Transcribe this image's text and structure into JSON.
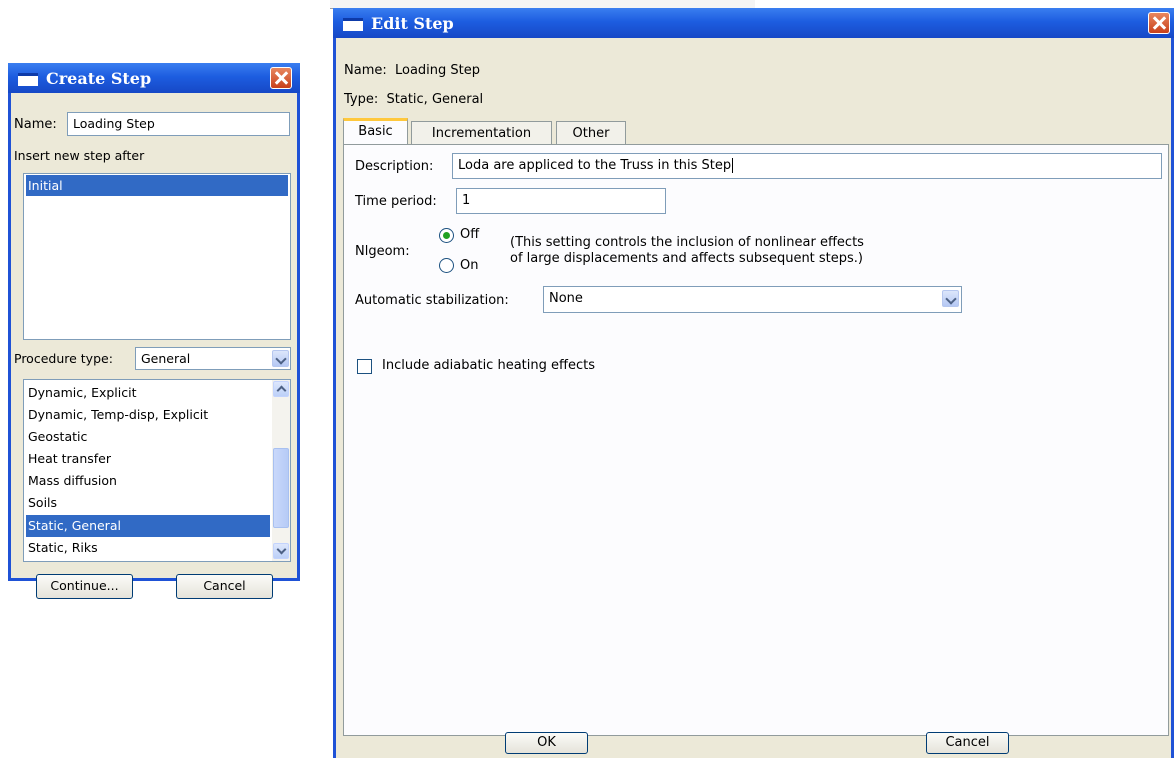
{
  "create_step": {
    "title": "Create Step",
    "name_label": "Name:",
    "name_value": "Loading Step",
    "insert_after_label": "Insert new step after",
    "existing_steps": [
      "Initial"
    ],
    "procedure_label": "Procedure type:",
    "procedure_value": "General",
    "procedures": [
      "Dynamic, Explicit",
      "Dynamic, Temp-disp, Explicit",
      "Geostatic",
      "Heat transfer",
      "Mass diffusion",
      "Soils",
      "Static, General",
      "Static, Riks"
    ],
    "selected_procedure": "Static, General",
    "continue_label": "Continue...",
    "cancel_label": "Cancel"
  },
  "edit_step": {
    "title": "Edit Step",
    "name_line": "Name:  Loading Step",
    "type_line": "Type:  Static, General",
    "tabs": [
      "Basic",
      "Incrementation",
      "Other"
    ],
    "active_tab": "Basic",
    "description_label": "Description:",
    "description_value": "Loda are appliced to the Truss in this Step",
    "time_period_label": "Time period:",
    "time_period_value": "1",
    "nlgeom_label": "Nlgeom:",
    "nlgeom_off": "Off",
    "nlgeom_on": "On",
    "nlgeom_selected": "Off",
    "nlgeom_note_1": "(This setting controls the inclusion of nonlinear effects",
    "nlgeom_note_2": "of large displacements and affects subsequent steps.)",
    "stabilization_label": "Automatic stabilization:",
    "stabilization_value": "None",
    "adiabatic_label": "Include adiabatic heating effects",
    "adiabatic_checked": false,
    "ok_label": "OK",
    "cancel_label": "Cancel"
  }
}
